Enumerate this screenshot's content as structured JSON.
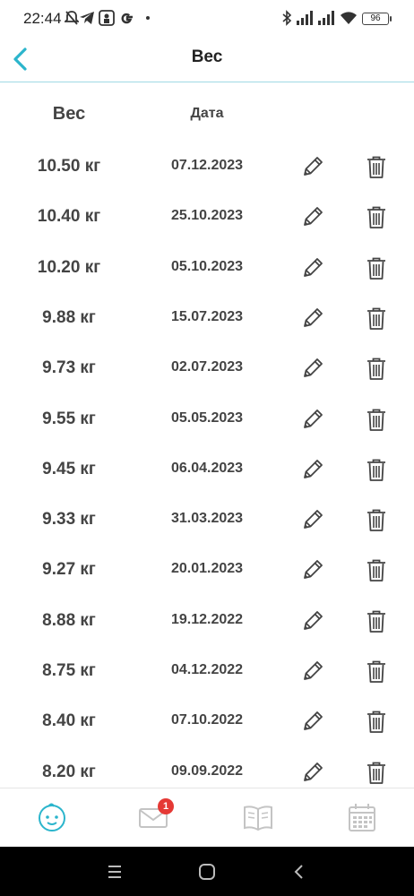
{
  "status_bar": {
    "time": "22:44",
    "battery": "96",
    "icons": [
      "mute-icon",
      "telegram-icon",
      "app-icon",
      "google-icon",
      "dot-icon",
      "bluetooth-icon",
      "signal-icon",
      "signal-icon",
      "wifi-icon",
      "battery-icon"
    ]
  },
  "header": {
    "title": "Вес",
    "back_icon": "chevron-left-icon"
  },
  "columns": {
    "weight": "Вес",
    "date": "Дата"
  },
  "rows": [
    {
      "weight": "10.50 кг",
      "date": "07.12.2023"
    },
    {
      "weight": "10.40 кг",
      "date": "25.10.2023"
    },
    {
      "weight": "10.20 кг",
      "date": "05.10.2023"
    },
    {
      "weight": "9.88 кг",
      "date": "15.07.2023"
    },
    {
      "weight": "9.73 кг",
      "date": "02.07.2023"
    },
    {
      "weight": "9.55 кг",
      "date": "05.05.2023"
    },
    {
      "weight": "9.45 кг",
      "date": "06.04.2023"
    },
    {
      "weight": "9.33 кг",
      "date": "31.03.2023"
    },
    {
      "weight": "9.27 кг",
      "date": "20.01.2023"
    },
    {
      "weight": "8.88 кг",
      "date": "19.12.2022"
    },
    {
      "weight": "8.75 кг",
      "date": "04.12.2022"
    },
    {
      "weight": "8.40 кг",
      "date": "07.10.2022"
    },
    {
      "weight": "8.20 кг",
      "date": "09.09.2022"
    }
  ],
  "tabbar": {
    "tabs": [
      "baby-icon",
      "mail-icon",
      "book-icon",
      "calendar-icon"
    ],
    "mail_badge": "1"
  },
  "colors": {
    "accent": "#2bb5cc",
    "icon_gray": "#c4c4c4",
    "text": "#444444",
    "badge": "#e53935"
  }
}
